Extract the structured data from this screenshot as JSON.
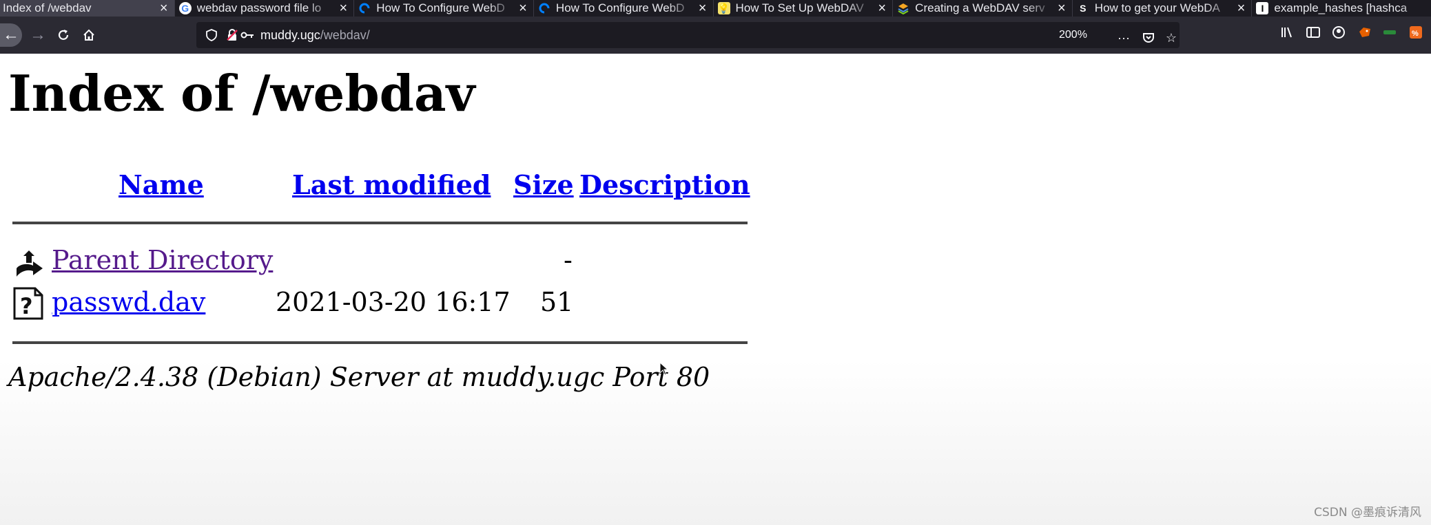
{
  "browser": {
    "tabs": [
      {
        "title": "Index of /webdav",
        "favicon": "none",
        "active": true
      },
      {
        "title": "webdav password file lo",
        "favicon": "google-icon"
      },
      {
        "title": "How To Configure WebD",
        "favicon": "digitalocean-icon"
      },
      {
        "title": "How To Configure WebD",
        "favicon": "digitalocean-icon"
      },
      {
        "title": "How To Set Up WebDAV",
        "favicon": "lightbulb-icon"
      },
      {
        "title": "Creating a WebDAV serv",
        "favicon": "stack-icon"
      },
      {
        "title": "How to get your WebDA",
        "favicon": "s-icon"
      },
      {
        "title": "example_hashes [hashca",
        "favicon": "hashcat-icon"
      }
    ],
    "url": {
      "host": "muddy.ugc",
      "path": "/webdav/"
    },
    "zoom": "200%"
  },
  "page": {
    "title": "Index of /webdav",
    "columns": {
      "name": "Name",
      "last_modified": "Last modified",
      "size": "Size",
      "description": "Description"
    },
    "rows": [
      {
        "name": "Parent Directory",
        "modified": "",
        "size": "-",
        "description": "",
        "icon": "back-folder-icon",
        "visited": true
      },
      {
        "name": "passwd.dav",
        "modified": "2021-03-20 16:17",
        "size": "51",
        "description": "",
        "icon": "unknown-file-icon",
        "visited": false
      }
    ],
    "address": "Apache/2.4.38 (Debian) Server at muddy.ugc Port 80"
  },
  "watermark": "CSDN @墨痕诉清风",
  "colors": {
    "link": "#0000ee",
    "visited_link": "#551a8b",
    "chrome_dark": "#1c1b22",
    "toolbar": "#2b2a33"
  }
}
